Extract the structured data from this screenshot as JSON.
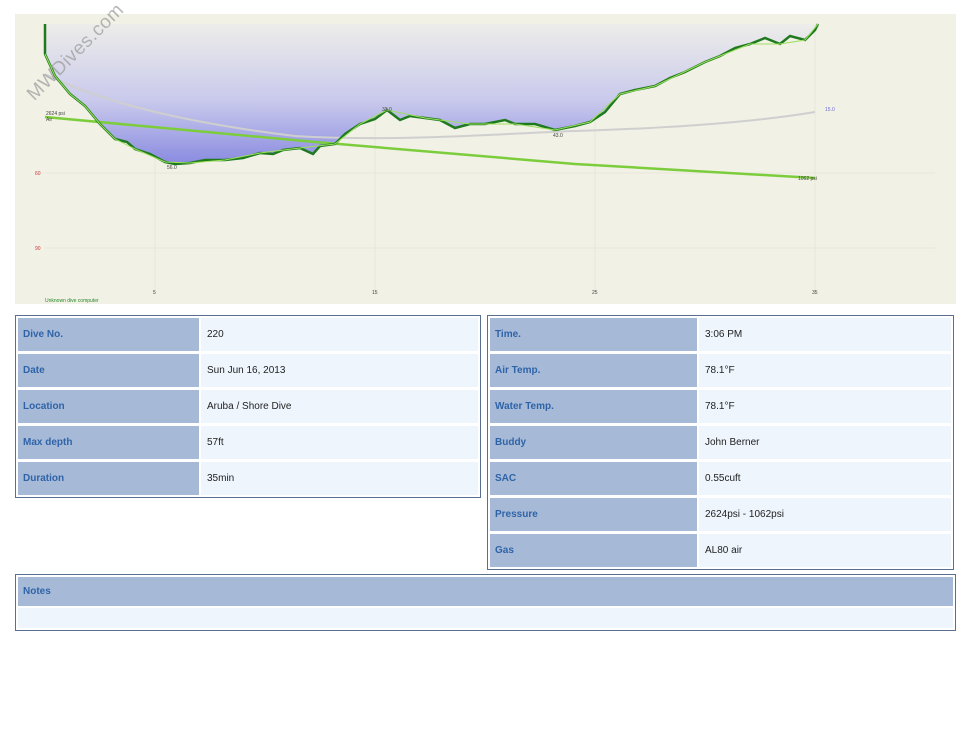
{
  "watermark": "MWDives.com",
  "profile": {
    "start_pressure_label": "2624 psi",
    "gas_label": "Air",
    "end_pressure_label": "1062 psi",
    "ceiling_label": "15.0",
    "depth_ticks": [
      "30",
      "60",
      "90"
    ],
    "time_ticks": [
      "5",
      "15",
      "25",
      "35"
    ],
    "max_depth_label": "56.0",
    "mid_label_1": "43.0",
    "mid_label_2": "33.0",
    "computer_label": "Unknown dive computer",
    "colors": {
      "depth_line": "#1f7a1f",
      "pressure_line": "#7ccd3c",
      "fill_top": "#f0f0e6",
      "fill_bottom": "#8a8be0",
      "background": "#f1f1e6"
    }
  },
  "left_table": [
    {
      "label": "Dive No.",
      "value": "220"
    },
    {
      "label": "Date",
      "value": "Sun Jun 16, 2013"
    },
    {
      "label": "Location",
      "value": "Aruba / Shore Dive"
    },
    {
      "label": "Max depth",
      "value": "57ft"
    },
    {
      "label": "Duration",
      "value": "35min"
    }
  ],
  "right_table": [
    {
      "label": "Time.",
      "value": "3:06 PM"
    },
    {
      "label": "Air Temp.",
      "value": "78.1°F"
    },
    {
      "label": "Water Temp.",
      "value": "78.1°F"
    },
    {
      "label": "Buddy",
      "value": "John Berner"
    },
    {
      "label": "SAC",
      "value": "0.55cuft"
    },
    {
      "label": "Pressure",
      "value": "2624psi - 1062psi"
    },
    {
      "label": "Gas",
      "value": "AL80 air"
    }
  ],
  "notes": {
    "title": "Notes",
    "body": ""
  }
}
